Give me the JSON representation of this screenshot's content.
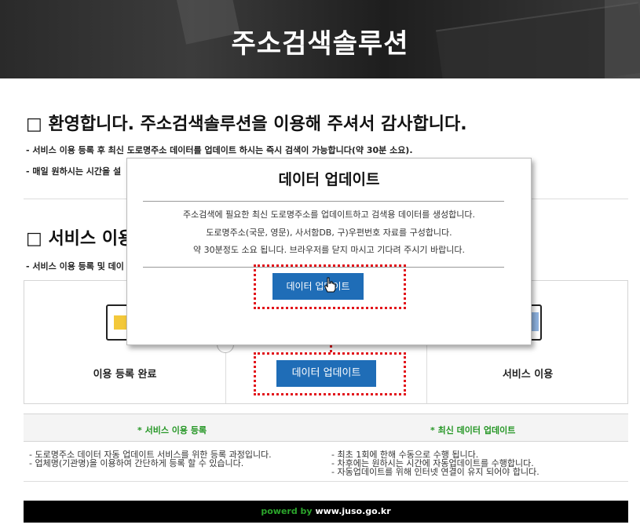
{
  "banner": {
    "title": "주소검색솔루션"
  },
  "welcome": {
    "title": "□ 환영합니다. 주소검색솔루션을 이용해 주셔서 감사합니다.",
    "line1": "- 서비스 이용 등록 후 최신 도로명주소 데이터를 업데이트 하시는 즉시 검색이 가능합니다(약 30분 소요).",
    "line2": "- 매일 원하시는 시간을 설"
  },
  "service": {
    "title": "□ 서비스 이용",
    "desc": "- 서비스 이용 등록 및 데이",
    "steps": [
      {
        "label": "이용 등록 완료",
        "icon": "monitor-icon"
      },
      {
        "button": "데이터 업데이트"
      },
      {
        "label": "서비스 이용",
        "icon": "monitor-icon"
      }
    ]
  },
  "info": {
    "col1_title": "* 서비스 이용 등록",
    "col2_title": "* 최신 데이터 업데이트",
    "col1_lines": [
      "- 도로명주소 데이터 자동 업데이트 서비스를 위한 등록 과정입니다.",
      "- 업체명(기관명)을 이용하여 간단하게 등록 할 수 있습니다."
    ],
    "col2_lines": [
      "- 최초 1회에 한해 수동으로 수행 됩니다.",
      "- 차후에는 원하시는 시간에 자동업데이트를 수행합니다.",
      "- 자동업데이트를 위해 인터넷 연결이 유지 되어야 합니다."
    ]
  },
  "footer": {
    "prefix": "powerd by",
    "site": "www.juso.go.kr"
  },
  "dialog": {
    "title": "데이터 업데이트",
    "lines": [
      "주소검색에 필요한 최신 도로명주소를 업데이트하고 검색용 데이터를 생성합니다.",
      "도로명주소(국문, 영문), 사서함DB, 구)우편번호 자료를 구성합니다.",
      "약 30분정도 소요 됩니다. 브라우저를 닫지 마시고 기다려 주시기 바랍니다."
    ],
    "button": "데이터 업데이트"
  },
  "colors": {
    "accent_blue": "#1f6db7",
    "highlight_red": "#e2141b",
    "green": "#249624"
  }
}
